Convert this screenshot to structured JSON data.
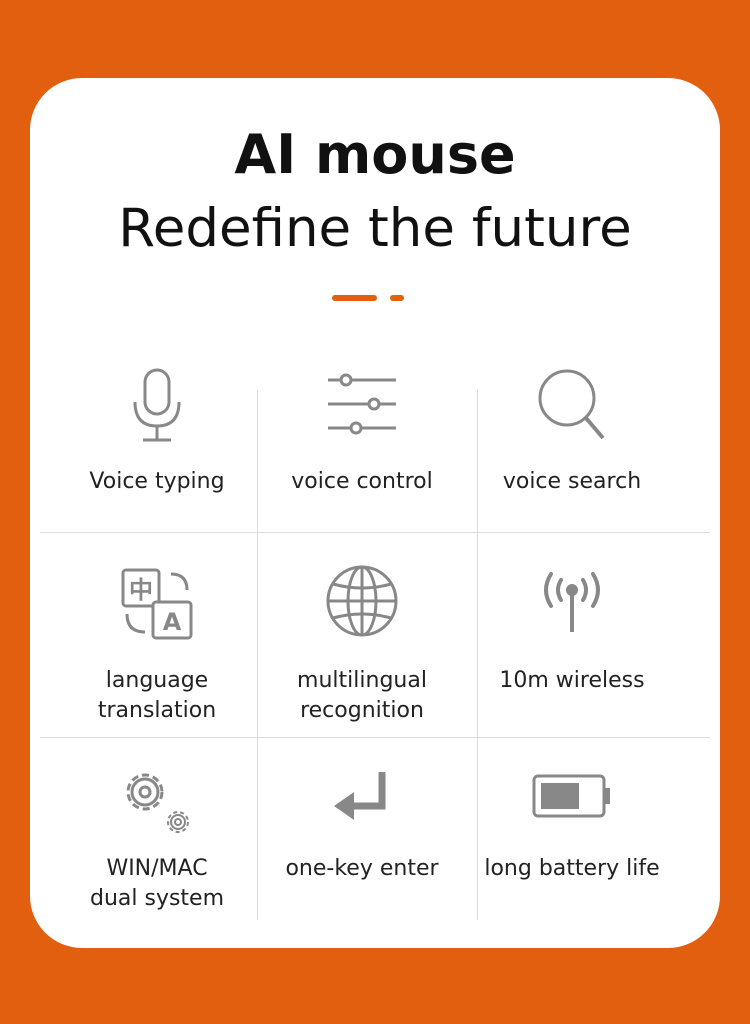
{
  "header": {
    "title": "AI mouse",
    "subtitle": "Redefine the future"
  },
  "colors": {
    "accent": "#e35f10",
    "icon": "#888888",
    "grid": "#dcdcdc"
  },
  "features": [
    {
      "label_line1": "Voice typing",
      "label_line2": "",
      "icon": "microphone-icon"
    },
    {
      "label_line1": "voice control",
      "label_line2": "",
      "icon": "sliders-icon"
    },
    {
      "label_line1": "voice search",
      "label_line2": "",
      "icon": "search-icon"
    },
    {
      "label_line1": "language",
      "label_line2": "translation",
      "icon": "translate-icon"
    },
    {
      "label_line1": "multilingual",
      "label_line2": "recognition",
      "icon": "globe-icon"
    },
    {
      "label_line1": "10m wireless",
      "label_line2": "",
      "icon": "wireless-antenna-icon"
    },
    {
      "label_line1": "WIN/MAC",
      "label_line2": "dual system",
      "icon": "gears-icon"
    },
    {
      "label_line1": "one-key enter",
      "label_line2": "",
      "icon": "enter-key-icon"
    },
    {
      "label_line1": "long battery life",
      "label_line2": "",
      "icon": "battery-icon"
    }
  ]
}
